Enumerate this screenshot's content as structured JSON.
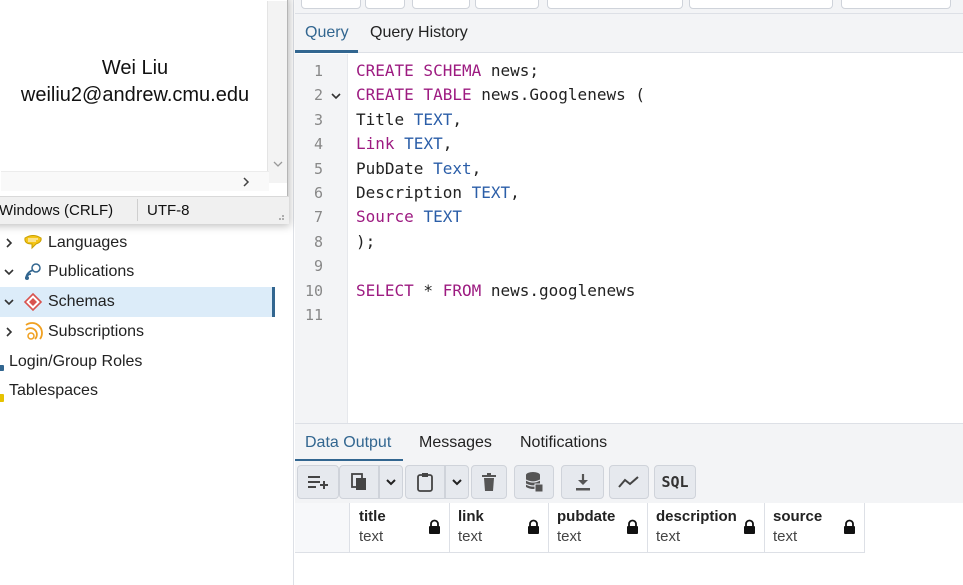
{
  "notepad": {
    "name": "Wei Liu",
    "email": "weiliu2@andrew.cmu.edu",
    "status_eol": "Windows (CRLF)",
    "status_encoding": "UTF-8"
  },
  "tree": {
    "items": [
      {
        "label": "Languages",
        "icon": "languages-icon",
        "chevron": "right"
      },
      {
        "label": "Publications",
        "icon": "publications-icon",
        "chevron": "down"
      },
      {
        "label": "Schemas",
        "icon": "schemas-icon",
        "chevron": "down",
        "selected": true
      },
      {
        "label": "Subscriptions",
        "icon": "subscriptions-icon",
        "chevron": "right"
      },
      {
        "label": "Login/Group Roles",
        "icon": "roles-icon"
      },
      {
        "label": "Tablespaces",
        "icon": "tablespaces-icon"
      }
    ]
  },
  "query_tabs": {
    "query": "Query",
    "history": "Query History"
  },
  "editor": {
    "line_numbers": [
      "1",
      "2",
      "3",
      "4",
      "5",
      "6",
      "7",
      "8",
      "9",
      "10",
      "11"
    ],
    "lines": [
      {
        "parts": [
          {
            "t": "CREATE SCHEMA",
            "c": "kw"
          },
          {
            "t": " news;",
            "c": ""
          }
        ]
      },
      {
        "parts": [
          {
            "t": "CREATE TABLE",
            "c": "kw"
          },
          {
            "t": " news.Googlenews (",
            "c": ""
          }
        ]
      },
      {
        "parts": [
          {
            "t": "Title ",
            "c": ""
          },
          {
            "t": "TEXT",
            "c": "ty"
          },
          {
            "t": ",",
            "c": ""
          }
        ]
      },
      {
        "parts": [
          {
            "t": "Link",
            "c": "kw"
          },
          {
            "t": " ",
            "c": ""
          },
          {
            "t": "TEXT",
            "c": "ty"
          },
          {
            "t": ",",
            "c": ""
          }
        ]
      },
      {
        "parts": [
          {
            "t": "PubDate ",
            "c": ""
          },
          {
            "t": "Text",
            "c": "ty"
          },
          {
            "t": ",",
            "c": ""
          }
        ]
      },
      {
        "parts": [
          {
            "t": "Description ",
            "c": ""
          },
          {
            "t": "TEXT",
            "c": "ty"
          },
          {
            "t": ",",
            "c": ""
          }
        ]
      },
      {
        "parts": [
          {
            "t": "Source",
            "c": "kw"
          },
          {
            "t": " ",
            "c": ""
          },
          {
            "t": "TEXT",
            "c": "ty"
          }
        ]
      },
      {
        "parts": [
          {
            "t": ");",
            "c": ""
          }
        ]
      },
      {
        "parts": []
      },
      {
        "parts": [
          {
            "t": "SELECT",
            "c": "kw"
          },
          {
            "t": " * ",
            "c": ""
          },
          {
            "t": "FROM",
            "c": "kw"
          },
          {
            "t": " news.googlenews",
            "c": ""
          }
        ]
      },
      {
        "parts": []
      }
    ]
  },
  "output_tabs": {
    "data_output": "Data Output",
    "messages": "Messages",
    "notifications": "Notifications"
  },
  "output_toolbar": {
    "sql_label": "SQL"
  },
  "result_grid": {
    "columns": [
      {
        "name": "title",
        "type": "text"
      },
      {
        "name": "link",
        "type": "text"
      },
      {
        "name": "pubdate",
        "type": "text"
      },
      {
        "name": "description",
        "type": "text"
      },
      {
        "name": "source",
        "type": "text"
      }
    ]
  },
  "colors": {
    "accent": "#326690",
    "keyword": "#9d1b81",
    "type": "#2b5ea8",
    "selected_row": "#dcecf9"
  }
}
